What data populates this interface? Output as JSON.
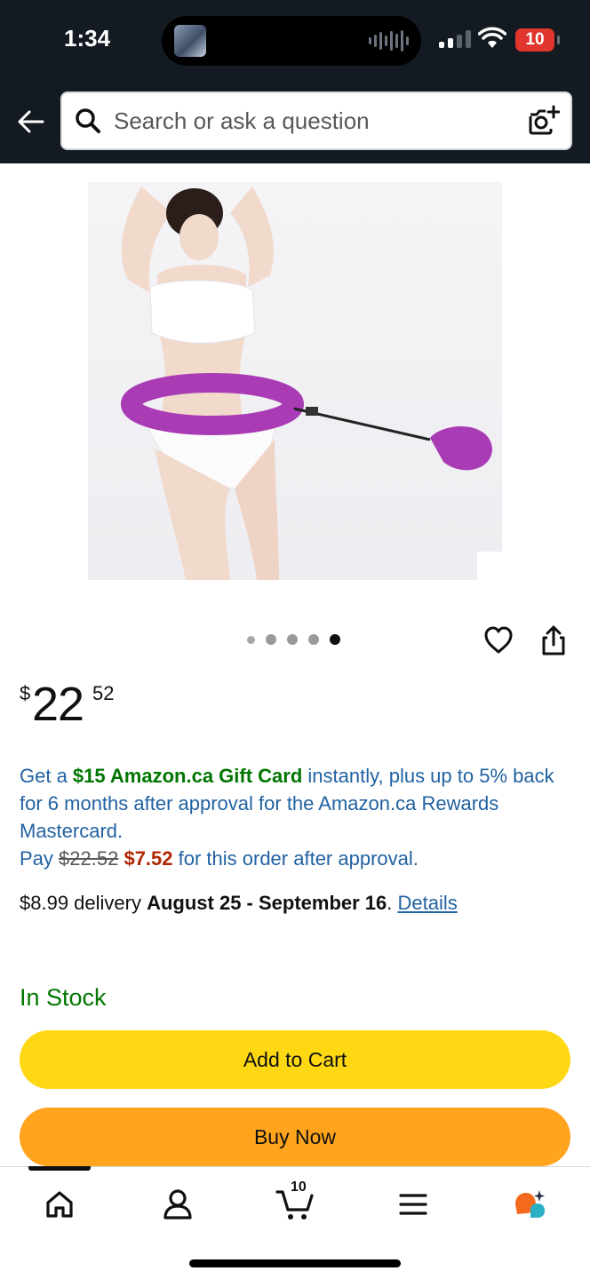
{
  "status_bar": {
    "time": "1:34",
    "battery": "10"
  },
  "search": {
    "placeholder": "Search or ask a question"
  },
  "product": {
    "image_alt": "Weighted smart hula hoop worn by woman",
    "carousel": {
      "total": 5,
      "active": 5
    }
  },
  "price": {
    "currency": "$",
    "whole": "22",
    "fraction": "52"
  },
  "offer": {
    "prefix": "Get a ",
    "highlight": "$15 Amazon.ca Gift Card",
    "body": " instantly, plus up to 5% back for 6 months after approval for the Amazon.ca Rewards Mastercard.",
    "pay_label": "Pay ",
    "old_price": "$22.52",
    "new_price": "$7.52",
    "pay_suffix": " for this order after approval."
  },
  "delivery": {
    "prefix": "$8.99 delivery ",
    "dates": "August 25 - September 16",
    "period": ". ",
    "details_link": "Details"
  },
  "stock": "In Stock",
  "buttons": {
    "add_to_cart": "Add to Cart",
    "buy_now": "Buy Now"
  },
  "nav": {
    "cart_count": "10"
  },
  "colors": {
    "header": "#131a22",
    "add_to_cart": "#ffd814",
    "buy_now": "#ffa41c",
    "link": "#2162a1",
    "in_stock": "#007600",
    "deal_price": "#b12704"
  }
}
